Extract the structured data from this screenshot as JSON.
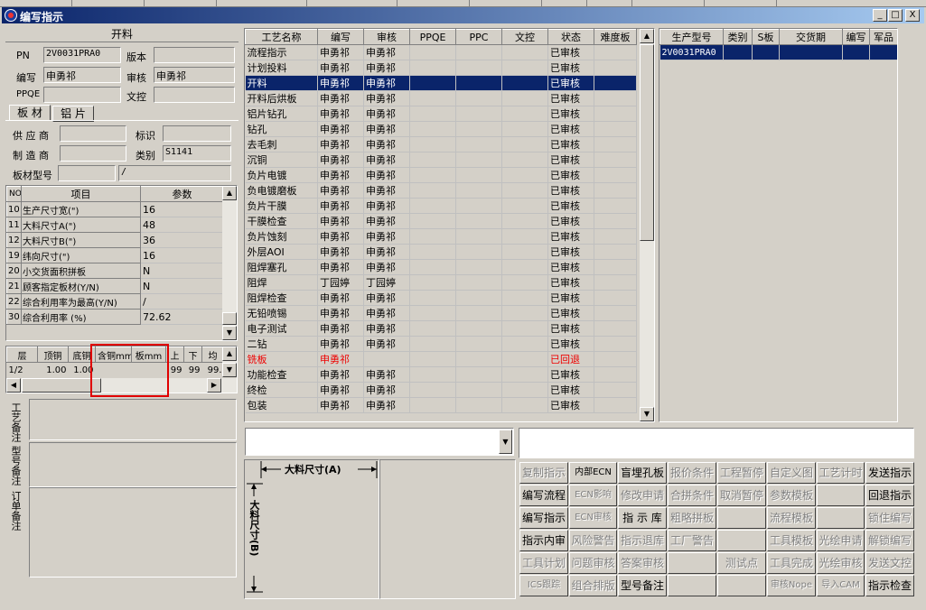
{
  "window": {
    "title": "编写指示",
    "minimize": "_",
    "restore": "□",
    "close": "X"
  },
  "left": {
    "header": "开料",
    "pn_label": "PN",
    "pn_value": "2V0031PRA0",
    "version_label": "版本",
    "version_value": "",
    "author_label": "编写",
    "author_value": "申勇祁",
    "reviewer_label": "审核",
    "reviewer_value": "申勇祁",
    "ppqe_label": "PPQE",
    "ppqe_value": "",
    "doccontrol_label": "文控",
    "doccontrol_value": "",
    "tabs": [
      "板 材",
      "铝 片"
    ],
    "supplier_label": "供 应 商",
    "supplier_value": "",
    "mark_label": "标识",
    "mark_value": "",
    "maker_label": "制 造 商",
    "maker_value": "",
    "category_label": "类别",
    "category_value": "S1141",
    "boardtype_label": "板材型号",
    "boardtype_value": "",
    "boardtype_value2": "/",
    "param_headers": [
      "NO",
      "项目",
      "参数"
    ],
    "params": [
      {
        "no": "10",
        "item": "生产尺寸宽(\")",
        "value": "16"
      },
      {
        "no": "11",
        "item": "大料尺寸A(\")",
        "value": "48"
      },
      {
        "no": "12",
        "item": "大料尺寸B(\")",
        "value": "36"
      },
      {
        "no": "19",
        "item": "纬向尺寸(\")",
        "value": "16"
      },
      {
        "no": "20",
        "item": "小交货面积拼板",
        "value": "N"
      },
      {
        "no": "21",
        "item": "顾客指定板材(Y/N)",
        "value": "N"
      },
      {
        "no": "22",
        "item": "综合利用率为最高(Y/N)",
        "value": "/"
      },
      {
        "no": "30",
        "item": "综合利用率 (%)",
        "value": "72.62"
      }
    ],
    "layer_headers": [
      "层",
      "顶铜",
      "底铜",
      "含铜mm",
      "板mm",
      "上",
      "下",
      "均"
    ],
    "layer_row": [
      "1/2",
      "1.00",
      "1.00",
      "",
      "",
      "99",
      "99",
      "99."
    ],
    "notes": [
      {
        "label": "工艺备注",
        "value": ""
      },
      {
        "label": "型号备注",
        "value": ""
      },
      {
        "label": "订单备注",
        "value": ""
      }
    ]
  },
  "process": {
    "headers": [
      "工艺名称",
      "编写",
      "审核",
      "PPQE",
      "PPC",
      "文控",
      "状态",
      "难度板"
    ],
    "rows": [
      {
        "name": "流程指示",
        "author": "申勇祁",
        "reviewer": "申勇祁",
        "status": "已审核",
        "state": "normal"
      },
      {
        "name": "计划投料",
        "author": "申勇祁",
        "reviewer": "申勇祁",
        "status": "已审核",
        "state": "normal"
      },
      {
        "name": "开料",
        "author": "申勇祁",
        "reviewer": "申勇祁",
        "status": "已审核",
        "state": "selected"
      },
      {
        "name": "开料后烘板",
        "author": "申勇祁",
        "reviewer": "申勇祁",
        "status": "已审核",
        "state": "normal"
      },
      {
        "name": "铝片钻孔",
        "author": "申勇祁",
        "reviewer": "申勇祁",
        "status": "已审核",
        "state": "normal"
      },
      {
        "name": "钻孔",
        "author": "申勇祁",
        "reviewer": "申勇祁",
        "status": "已审核",
        "state": "normal"
      },
      {
        "name": "去毛刺",
        "author": "申勇祁",
        "reviewer": "申勇祁",
        "status": "已审核",
        "state": "normal"
      },
      {
        "name": "沉铜",
        "author": "申勇祁",
        "reviewer": "申勇祁",
        "status": "已审核",
        "state": "normal"
      },
      {
        "name": "负片电镀",
        "author": "申勇祁",
        "reviewer": "申勇祁",
        "status": "已审核",
        "state": "normal"
      },
      {
        "name": "负电镀磨板",
        "author": "申勇祁",
        "reviewer": "申勇祁",
        "status": "已审核",
        "state": "normal"
      },
      {
        "name": "负片干膜",
        "author": "申勇祁",
        "reviewer": "申勇祁",
        "status": "已审核",
        "state": "normal"
      },
      {
        "name": "干膜检查",
        "author": "申勇祁",
        "reviewer": "申勇祁",
        "status": "已审核",
        "state": "normal"
      },
      {
        "name": "负片蚀刻",
        "author": "申勇祁",
        "reviewer": "申勇祁",
        "status": "已审核",
        "state": "normal"
      },
      {
        "name": "外层AOI",
        "author": "申勇祁",
        "reviewer": "申勇祁",
        "status": "已审核",
        "state": "normal"
      },
      {
        "name": "阻焊塞孔",
        "author": "申勇祁",
        "reviewer": "申勇祁",
        "status": "已审核",
        "state": "normal"
      },
      {
        "name": "阻焊",
        "author": "丁园婷",
        "reviewer": "丁园婷",
        "status": "已审核",
        "state": "normal"
      },
      {
        "name": "阻焊检查",
        "author": "申勇祁",
        "reviewer": "申勇祁",
        "status": "已审核",
        "state": "normal"
      },
      {
        "name": "无铅喷锡",
        "author": "申勇祁",
        "reviewer": "申勇祁",
        "status": "已审核",
        "state": "normal"
      },
      {
        "name": "电子测试",
        "author": "申勇祁",
        "reviewer": "申勇祁",
        "status": "已审核",
        "state": "normal"
      },
      {
        "name": "二钻",
        "author": "申勇祁",
        "reviewer": "申勇祁",
        "status": "已审核",
        "state": "normal"
      },
      {
        "name": "铣板",
        "author": "申勇祁",
        "reviewer": "",
        "status": "已回退",
        "state": "returned"
      },
      {
        "name": "功能检查",
        "author": "申勇祁",
        "reviewer": "申勇祁",
        "status": "已审核",
        "state": "normal"
      },
      {
        "name": "终检",
        "author": "申勇祁",
        "reviewer": "申勇祁",
        "status": "已审核",
        "state": "normal"
      },
      {
        "name": "包装",
        "author": "申勇祁",
        "reviewer": "申勇祁",
        "status": "已审核",
        "state": "normal"
      }
    ]
  },
  "product": {
    "headers": [
      "生产型号",
      "类别",
      "S板",
      "交货期",
      "编写",
      "军品"
    ],
    "rows": [
      [
        "2V0031PRA0",
        "",
        "",
        "",
        "",
        ""
      ]
    ]
  },
  "diagram": {
    "label_a": "大料尺寸(A)",
    "label_b": "大料尺寸(B)"
  },
  "buttons": [
    [
      {
        "label": "复制指示",
        "enabled": false
      },
      {
        "label": "内部ECN",
        "enabled": true
      },
      {
        "label": "盲埋孔板",
        "enabled": true
      },
      {
        "label": "报价条件",
        "enabled": false
      },
      {
        "label": "工程暂停",
        "enabled": false
      },
      {
        "label": "自定义图",
        "enabled": false
      },
      {
        "label": "工艺计时",
        "enabled": false
      },
      {
        "label": "发送指示",
        "enabled": true
      }
    ],
    [
      {
        "label": "编写流程",
        "enabled": true
      },
      {
        "label": "ECN影响",
        "enabled": false
      },
      {
        "label": "修改申请",
        "enabled": false
      },
      {
        "label": "合拼条件",
        "enabled": false
      },
      {
        "label": "取消暂停",
        "enabled": false
      },
      {
        "label": "参数模板",
        "enabled": false
      },
      {
        "label": "",
        "enabled": false
      },
      {
        "label": "回退指示",
        "enabled": true
      }
    ],
    [
      {
        "label": "编写指示",
        "enabled": true
      },
      {
        "label": "ECN审核",
        "enabled": false
      },
      {
        "label": "指 示 库",
        "enabled": true
      },
      {
        "label": "粗略拼板",
        "enabled": false
      },
      {
        "label": "",
        "enabled": false
      },
      {
        "label": "流程模板",
        "enabled": false
      },
      {
        "label": "",
        "enabled": false
      },
      {
        "label": "锁住编写",
        "enabled": false
      }
    ],
    [
      {
        "label": "指示内审",
        "enabled": true
      },
      {
        "label": "风险警告",
        "enabled": false
      },
      {
        "label": "指示退库",
        "enabled": false
      },
      {
        "label": "工厂警告",
        "enabled": false
      },
      {
        "label": "",
        "enabled": false
      },
      {
        "label": "工具模板",
        "enabled": false
      },
      {
        "label": "光绘申请",
        "enabled": false
      },
      {
        "label": "解锁编写",
        "enabled": false
      }
    ],
    [
      {
        "label": "工具计划",
        "enabled": false
      },
      {
        "label": "问题审核",
        "enabled": false
      },
      {
        "label": "答案审核",
        "enabled": false
      },
      {
        "label": "",
        "enabled": false
      },
      {
        "label": "测试点",
        "enabled": false
      },
      {
        "label": "工具完成",
        "enabled": false
      },
      {
        "label": "光绘审核",
        "enabled": false
      },
      {
        "label": "发送文控",
        "enabled": false
      }
    ],
    [
      {
        "label": "ICS跟踪",
        "enabled": false
      },
      {
        "label": "组合排版",
        "enabled": false
      },
      {
        "label": "型号备注",
        "enabled": true
      },
      {
        "label": "",
        "enabled": false
      },
      {
        "label": "",
        "enabled": false
      },
      {
        "label": "审核Nope",
        "enabled": false
      },
      {
        "label": "导入CAM",
        "enabled": false
      },
      {
        "label": "指示检查",
        "enabled": true
      }
    ]
  ],
  "colors": {
    "title_start": "#0a246a",
    "title_end": "#a6caf0",
    "selection": "#0a246a",
    "returned": "#e00000",
    "highlight_box": "#e00000"
  }
}
